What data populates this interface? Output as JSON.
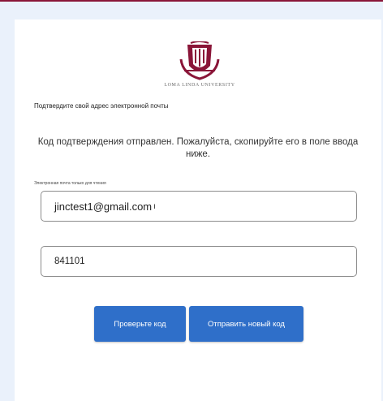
{
  "brand": {
    "university_name": "LOMA LINDA UNIVERSITY",
    "logo_icon": "university-crest-icon",
    "accent_color": "#8a1538"
  },
  "page": {
    "heading": "Подтвердите свой адрес электронной почты",
    "info_message": "Код подтверждения отправлен. Пожалуйста, скопируйте его в поле ввода ниже."
  },
  "email_field": {
    "label": "Электронная почта только для чтения",
    "value": "jinctest1@gmail.com",
    "caret_icon": "text-cursor-icon"
  },
  "code_field": {
    "value": "841101"
  },
  "buttons": {
    "verify_label": "Проверьте код",
    "resend_label": "Отправить новый код",
    "color": "#2f6fc9"
  }
}
